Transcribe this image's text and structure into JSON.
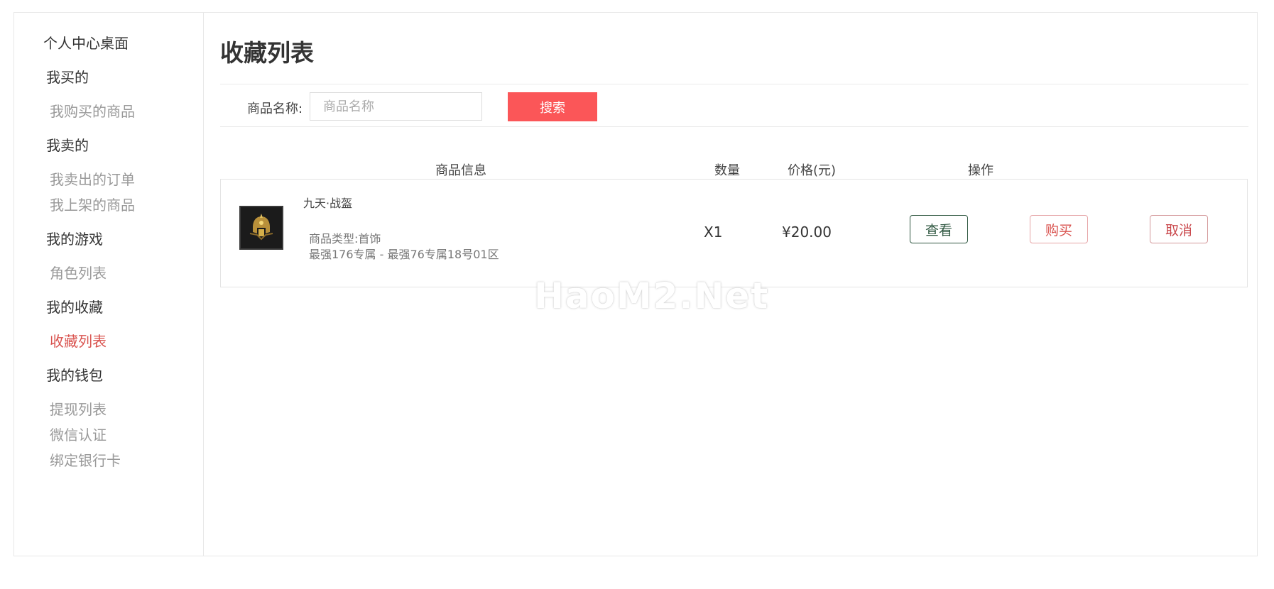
{
  "sidebar": {
    "desktop": "个人中心桌面",
    "groups": [
      {
        "label": "我买的",
        "items": [
          "我购买的商品"
        ]
      },
      {
        "label": "我卖的",
        "items": [
          "我卖出的订单",
          "我上架的商品"
        ]
      },
      {
        "label": "我的游戏",
        "items": [
          "角色列表"
        ]
      },
      {
        "label": "我的收藏",
        "items": [
          "收藏列表"
        ]
      },
      {
        "label": "我的钱包",
        "items": [
          "提现列表",
          "微信认证",
          "绑定银行卡"
        ]
      }
    ],
    "active_item": "收藏列表"
  },
  "main": {
    "title": "收藏列表",
    "search": {
      "label": "商品名称:",
      "placeholder": "商品名称",
      "value": "",
      "button": "搜索"
    },
    "table": {
      "headers": [
        "商品信息",
        "数量",
        "价格(元)",
        "操作"
      ],
      "rows": [
        {
          "name": "九天·战盔",
          "type": "商品类型:首饰",
          "server": "最强176专属 - 最强76专属18号01区",
          "quantity": "X1",
          "price": "¥20.00",
          "actions": [
            "查看",
            "购买",
            "取消"
          ]
        }
      ]
    }
  },
  "watermark": "HaoM2.Net",
  "colors": {
    "accent": "#fb5658",
    "active_nav": "#d9534f",
    "view_button": "#2f5741"
  }
}
